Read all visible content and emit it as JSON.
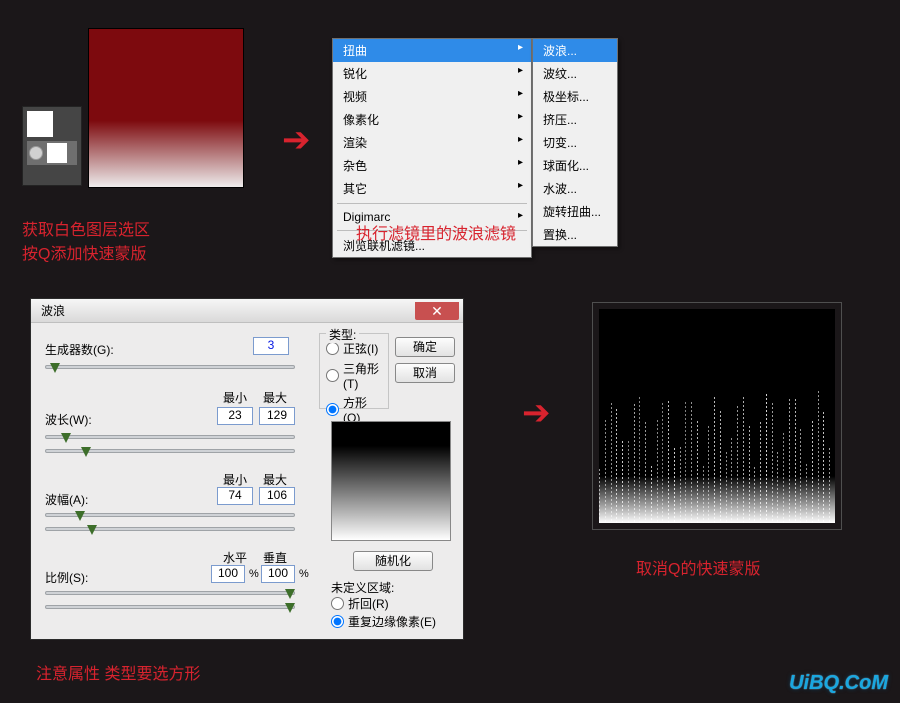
{
  "captions": {
    "selection": "获取白色图层选区\n按Q添加快速蒙版",
    "filter": "执行滤镜里的波浪滤镜",
    "attr_note": "注意属性  类型要选方形",
    "cancel_q": "取消Q的快速蒙版"
  },
  "menu": {
    "items": [
      {
        "label": "扭曲",
        "hi": true
      },
      {
        "label": "锐化"
      },
      {
        "label": "视频"
      },
      {
        "label": "像素化"
      },
      {
        "label": "渲染"
      },
      {
        "label": "杂色"
      },
      {
        "label": "其它"
      }
    ],
    "digimarc": "Digimarc",
    "browse": "浏览联机滤镜..."
  },
  "submenu": {
    "items": [
      "波浪...",
      "波纹...",
      "极坐标...",
      "挤压...",
      "切变...",
      "球面化...",
      "水波...",
      "旋转扭曲...",
      "置换..."
    ],
    "hi_index": 0
  },
  "wave_dialog": {
    "title": "波浪",
    "generators_label": "生成器数(G):",
    "generators_value": "3",
    "min_label": "最小",
    "max_label": "最大",
    "wavelength_label": "波长(W):",
    "wavelength_min": "23",
    "wavelength_max": "129",
    "amplitude_label": "波幅(A):",
    "amplitude_min": "74",
    "amplitude_max": "106",
    "horiz_label": "水平",
    "vert_label": "垂直",
    "scale_label": "比例(S):",
    "scale_h": "100",
    "scale_v": "100",
    "percent": "%",
    "type_legend": "类型:",
    "type_sine": "正弦(I)",
    "type_triangle": "三角形(T)",
    "type_square": "方形(Q)",
    "ok": "确定",
    "cancel": "取消",
    "randomize": "随机化",
    "undefined_area": "未定义区域:",
    "wrap": "折回(R)",
    "repeat_edge": "重复边缘像素(E)"
  },
  "watermark": "UiBQ.CoM"
}
